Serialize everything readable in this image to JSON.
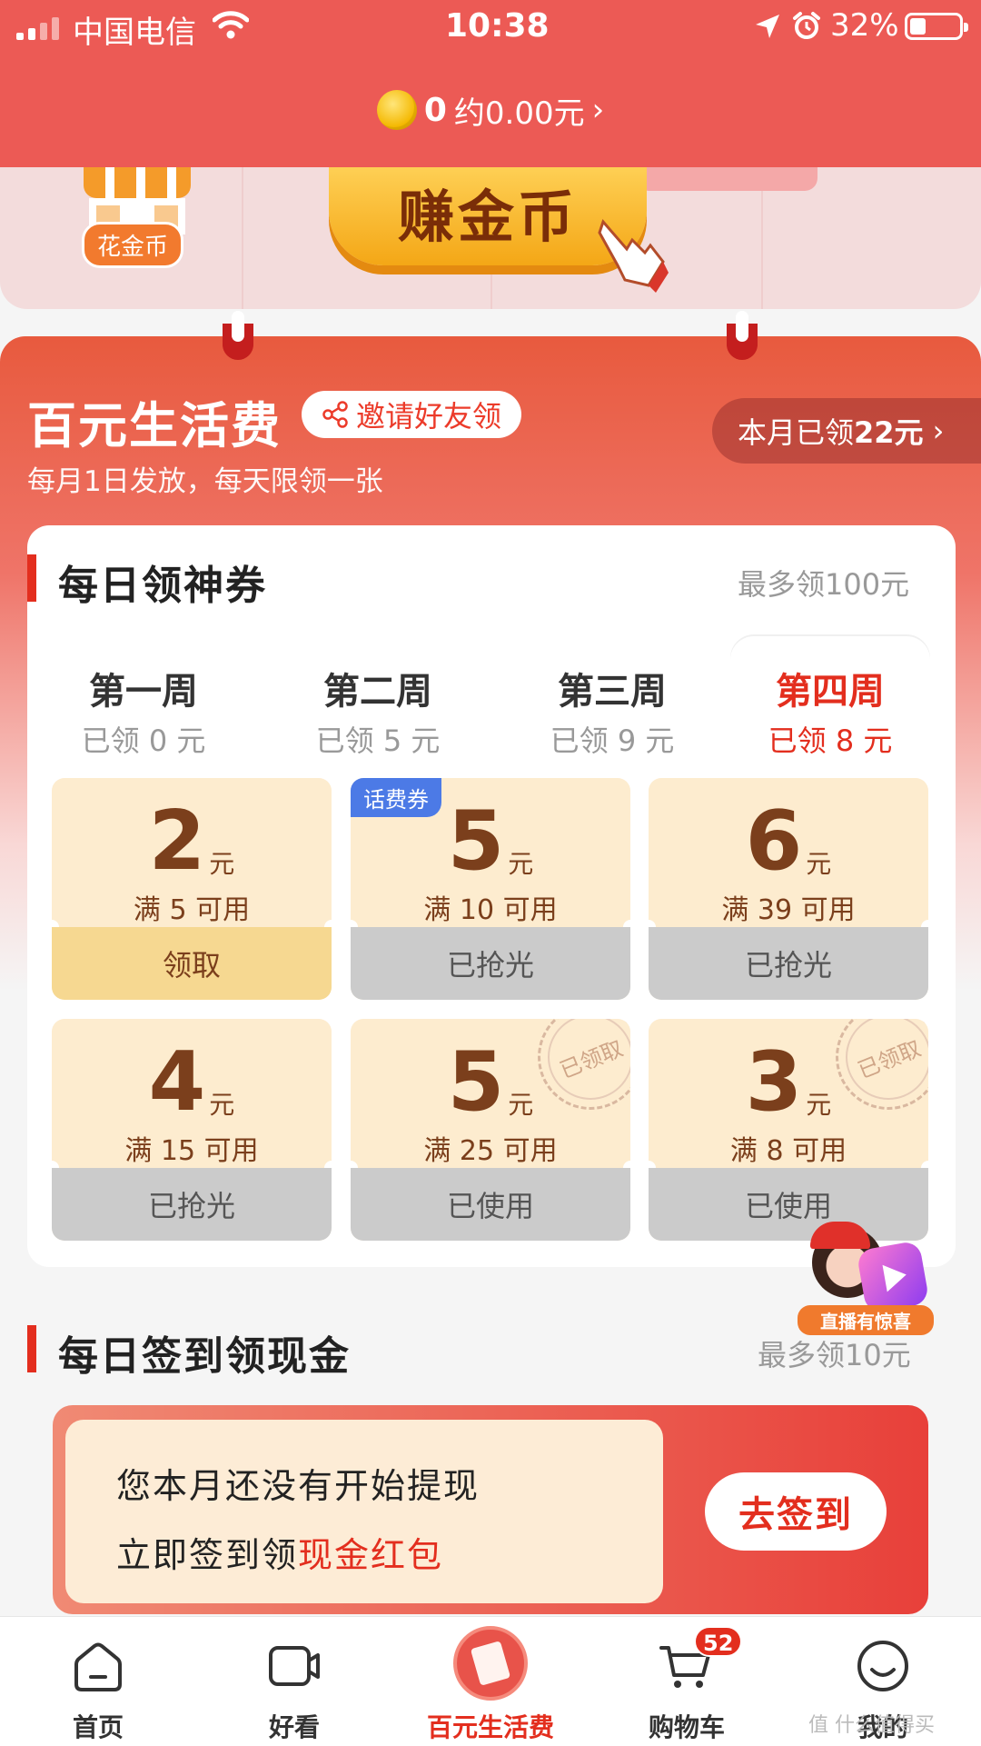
{
  "status_bar": {
    "carrier": "中国电信",
    "time": "10:38",
    "battery_percent": "32%",
    "battery_level": 0.32,
    "icons": [
      "signal-icon",
      "wifi-icon",
      "location-arrow-icon",
      "alarm-icon",
      "battery-icon"
    ]
  },
  "header": {
    "coin_count": "0",
    "coin_value": "约0.00元",
    "chevron": "›"
  },
  "banner": {
    "spend_label": "花金币",
    "earn_label": "赚金币"
  },
  "section": {
    "title": "百元生活费",
    "invite_label": "邀请好友领",
    "subtitle": "每月1日发放，每天限领一张",
    "month_prefix": "本月已领",
    "month_amount": "22元",
    "chevron": "›"
  },
  "daily_coupons": {
    "title": "每日领神券",
    "max_label": "最多领100元",
    "weeks": [
      {
        "name": "第一周",
        "value": "已领 0 元",
        "active": false
      },
      {
        "name": "第二周",
        "value": "已领 5 元",
        "active": false
      },
      {
        "name": "第三周",
        "value": "已领 9 元",
        "active": false
      },
      {
        "name": "第四周",
        "value": "已领 8 元",
        "active": true
      }
    ],
    "coupons": [
      {
        "amount": "2",
        "unit": "元",
        "condition": "满 5 可用",
        "action": "领取",
        "state": "claimable"
      },
      {
        "amount": "5",
        "unit": "元",
        "condition": "满 10 可用",
        "action": "已抢光",
        "state": "sold-out",
        "tag": "话费券"
      },
      {
        "amount": "6",
        "unit": "元",
        "condition": "满 39 可用",
        "action": "已抢光",
        "state": "sold-out"
      },
      {
        "amount": "4",
        "unit": "元",
        "condition": "满 15 可用",
        "action": "已抢光",
        "state": "sold-out"
      },
      {
        "amount": "5",
        "unit": "元",
        "condition": "满 25 可用",
        "action": "已使用",
        "state": "used",
        "stamp": "已领取"
      },
      {
        "amount": "3",
        "unit": "元",
        "condition": "满 8 可用",
        "action": "已使用",
        "state": "used",
        "stamp": "已领取"
      }
    ]
  },
  "live_badge": {
    "label": "直播有惊喜"
  },
  "daily_signin": {
    "title": "每日签到领现金",
    "max_label": "最多领10元",
    "line1": "您本月还没有开始提现",
    "line2_prefix": "立即签到领",
    "line2_highlight": "现金红包",
    "button": "去签到"
  },
  "tabbar": {
    "tabs": [
      {
        "label": "首页",
        "icon": "home-icon",
        "active": false
      },
      {
        "label": "好看",
        "icon": "video-icon",
        "active": false
      },
      {
        "label": "百元生活费",
        "icon": "living-allowance-icon",
        "active": true
      },
      {
        "label": "购物车",
        "icon": "cart-icon",
        "active": false,
        "badge": "52"
      },
      {
        "label": "我的",
        "icon": "smile-profile-icon",
        "active": false
      }
    ]
  },
  "watermark": "值 什么值得买",
  "colors": {
    "brand_red": "#e32e1e",
    "header_red": "#ec5a55",
    "coupon_bg": "#fdeccf",
    "coupon_brown": "#7b3f1c",
    "claim_gold": "#f6d891",
    "tag_blue": "#4c7ae6"
  }
}
